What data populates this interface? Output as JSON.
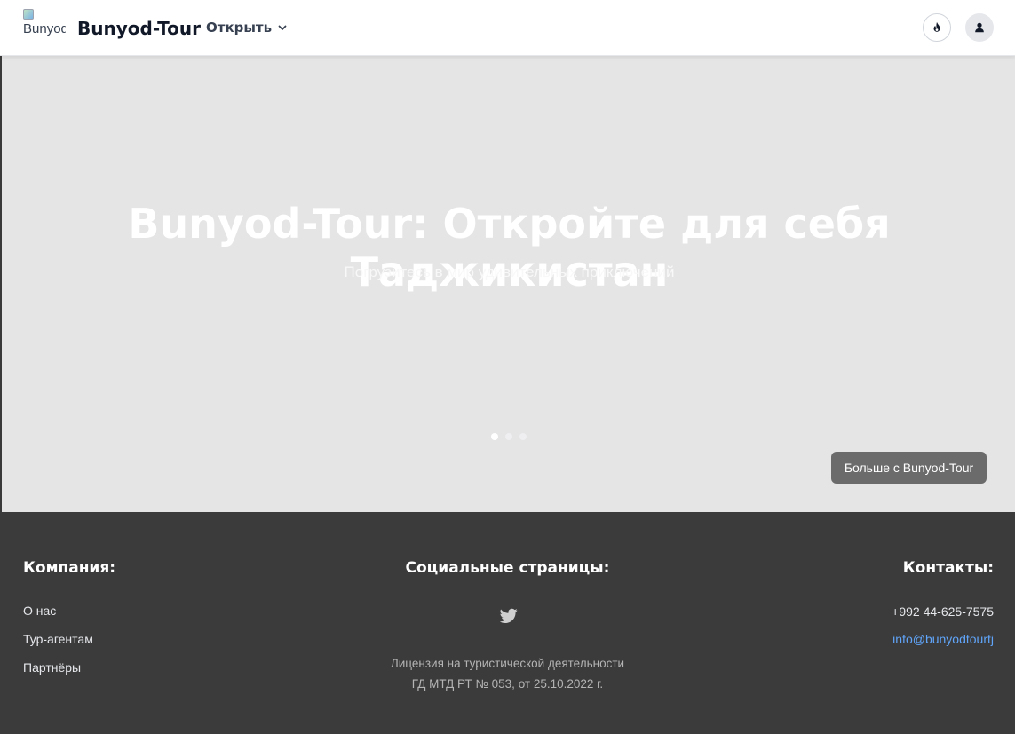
{
  "header": {
    "logo_alt": "Bunyod",
    "brand": "Bunyod-Tour",
    "open_menu_label": "Открыть"
  },
  "hero": {
    "title": "Bunyod-Tour: Откройте для себя Таджикистан",
    "subtitle": "Погрузитесь в мир удивительных приключений",
    "slides_count": 3,
    "active_slide": 1,
    "more_button": "Больше с Bunyod-Tour"
  },
  "footer": {
    "company": {
      "heading": "Компания:",
      "links": [
        "О нас",
        "Тур-агентам",
        "Партнёры"
      ]
    },
    "social": {
      "heading": "Социальные страницы:",
      "icons": [
        "twitter-icon"
      ],
      "license_line1": "Лицензия на туристической деятельности",
      "license_line2": "ГД МТД РТ № 053, от 25.10.2022 г."
    },
    "contacts": {
      "heading": "Контакты:",
      "phone": "+992 44-625-7575",
      "email": "info@bunyodtourtj"
    }
  },
  "colors": {
    "hero_bg": "#e5e5e5",
    "footer_bg": "#3b3b3b",
    "button_bg": "#6b6b6b",
    "email_link": "#60a5fa"
  }
}
